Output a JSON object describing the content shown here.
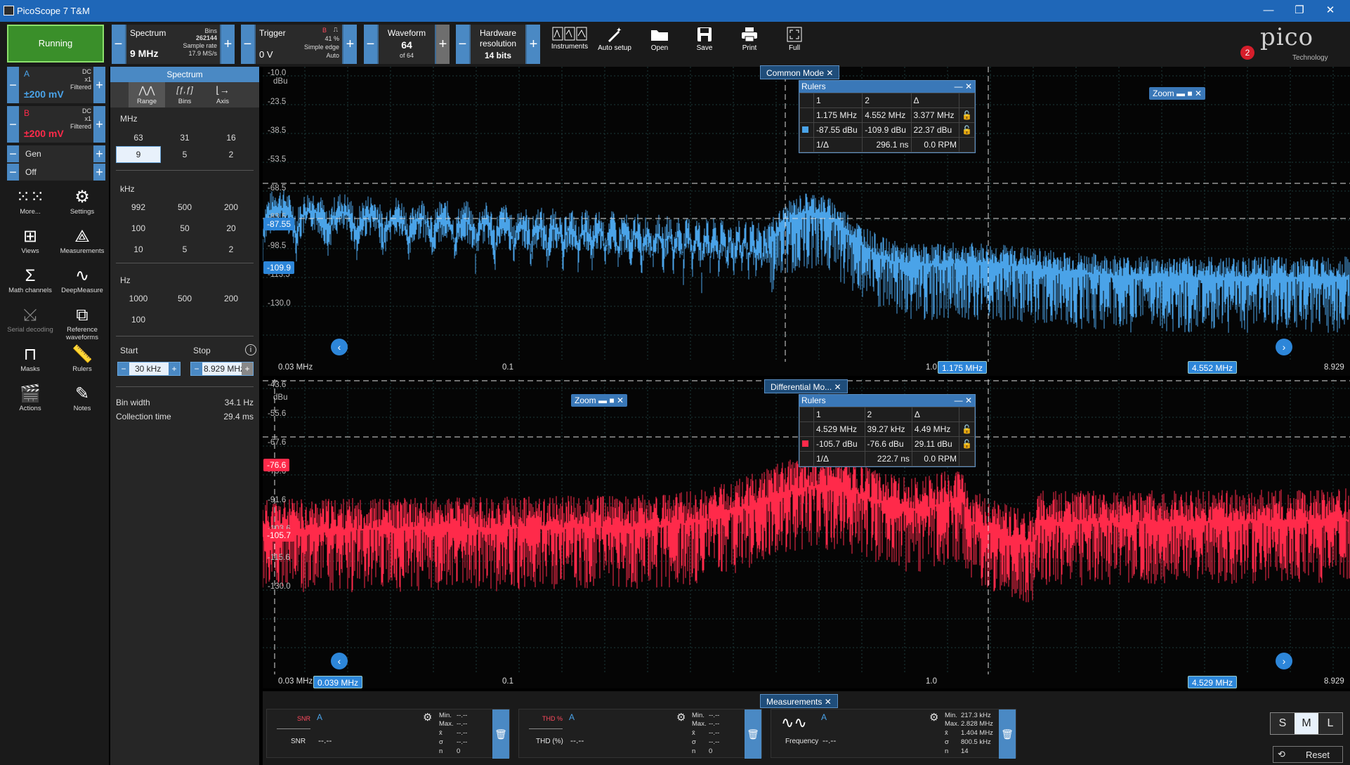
{
  "app": {
    "title": "PicoScope 7 T&M"
  },
  "toolbar": {
    "run_state": "Running",
    "spectrum": {
      "label": "Spectrum",
      "value": "9 MHz",
      "bins_label": "Bins",
      "bins": "262144",
      "sample_rate_label": "Sample rate",
      "sample_rate": "17.9 MS/s"
    },
    "trigger": {
      "label": "Trigger",
      "value": "0 V",
      "channel": "B",
      "percent": "41 %",
      "type": "Simple edge",
      "mode": "Auto"
    },
    "waveform": {
      "label": "Waveform",
      "value": "64",
      "sub": "of 64"
    },
    "resolution": {
      "label1": "Hardware",
      "label2": "resolution",
      "value": "14 bits"
    },
    "tools": [
      {
        "label": "Instruments"
      },
      {
        "label": "Auto setup"
      },
      {
        "label": "Open"
      },
      {
        "label": "Save"
      },
      {
        "label": "Print"
      },
      {
        "label": "Full"
      }
    ],
    "logo_text": "pico",
    "logo_sub": "Technology",
    "notification_count": "2"
  },
  "channels": [
    {
      "name": "A",
      "coupling": "DC",
      "probe": "x1",
      "filter": "Filtered",
      "range": "±200 mV",
      "color": "#4aa3e8"
    },
    {
      "name": "B",
      "coupling": "DC",
      "probe": "x1",
      "filter": "Filtered",
      "range": "±200 mV",
      "color": "#ff2a4a"
    }
  ],
  "gen": {
    "label": "Gen",
    "state": "Off"
  },
  "sidebar_tools": [
    {
      "label": "More...",
      "icon": "grid-dots-icon"
    },
    {
      "label": "Settings",
      "icon": "gear-icon"
    },
    {
      "label": "Views",
      "icon": "views-icon"
    },
    {
      "label": "Measurements",
      "icon": "measurements-icon"
    },
    {
      "label": "Math channels",
      "icon": "sigma-icon"
    },
    {
      "label": "DeepMeasure",
      "icon": "deepmeasure-icon"
    },
    {
      "label": "Serial decoding",
      "icon": "serial-icon"
    },
    {
      "label": "Reference waveforms",
      "icon": "reference-icon"
    },
    {
      "label": "Masks",
      "icon": "masks-icon"
    },
    {
      "label": "Rulers",
      "icon": "rulers-icon"
    },
    {
      "label": "Actions",
      "icon": "actions-icon"
    },
    {
      "label": "Notes",
      "icon": "notes-icon"
    }
  ],
  "spectrum_panel": {
    "title": "Spectrum",
    "tabs": [
      "Range",
      "Bins",
      "Axis"
    ],
    "mhz_label": "MHz",
    "mhz": [
      "63",
      "31",
      "16",
      "9",
      "5",
      "2"
    ],
    "mhz_selected": "9",
    "khz_label": "kHz",
    "khz": [
      "992",
      "500",
      "200",
      "100",
      "50",
      "20",
      "10",
      "5",
      "2"
    ],
    "hz_label": "Hz",
    "hz": [
      "1000",
      "500",
      "200",
      "100"
    ],
    "start_label": "Start",
    "stop_label": "Stop",
    "start": "30 kHz",
    "stop": "8.929 MHz",
    "bin_width_label": "Bin width",
    "bin_width": "34.1 Hz",
    "collection_time_label": "Collection time",
    "collection_time": "29.4 ms"
  },
  "scope1": {
    "title": "Common Mode",
    "unit": "dBu",
    "y_ticks": [
      "-10.0",
      "-23.5",
      "-38.5",
      "-53.5",
      "-68.5",
      "-83.5",
      "-98.5",
      "-113.5",
      "-130.0"
    ],
    "x_ticks": [
      "0.03 MHz",
      "0.1",
      "1.0",
      "8.929"
    ],
    "ruler_h1": "-87.55",
    "ruler_h2": "-109.9",
    "ruler_v1": "1.175 MHz",
    "ruler_v2": "4.552 MHz",
    "rulers": {
      "title": "Rulers",
      "c1": "1",
      "c2": "2",
      "c3": "Δ",
      "r1": [
        "1.175 MHz",
        "4.552 MHz",
        "3.377 MHz"
      ],
      "r2": [
        "-87.55 dBu",
        "-109.9 dBu",
        "22.37 dBu"
      ],
      "r3": [
        "1/Δ",
        "296.1 ns",
        "0.0 RPM"
      ]
    },
    "zoom": "Zoom",
    "chart_data": {
      "type": "line",
      "series": [
        {
          "name": "A",
          "color": "#4aa3e8"
        }
      ],
      "xlim": [
        0.03,
        8.929
      ],
      "ylim": [
        -140,
        -10
      ],
      "xscale": "log"
    }
  },
  "scope2": {
    "title": "Differential Mo...",
    "unit": "dBu",
    "y_ticks": [
      "-43.6",
      "-55.6",
      "-67.6",
      "-79.6",
      "-91.6",
      "-103.6",
      "-115.6",
      "-130.0"
    ],
    "x_ticks": [
      "0.03 MHz",
      "0.1",
      "1.0",
      "8.929"
    ],
    "ruler_h1": "-76.6",
    "ruler_h2": "-105.7",
    "ruler_v1": "0.039 MHz",
    "ruler_v2": "4.529 MHz",
    "rulers": {
      "title": "Rulers",
      "c1": "1",
      "c2": "2",
      "c3": "Δ",
      "r1": [
        "4.529 MHz",
        "39.27 kHz",
        "4.49 MHz"
      ],
      "r2": [
        "-105.7 dBu",
        "-76.6 dBu",
        "29.11 dBu"
      ],
      "r3": [
        "1/Δ",
        "222.7 ns",
        "0.0 RPM"
      ]
    },
    "zoom": "Zoom",
    "chart_data": {
      "type": "line",
      "series": [
        {
          "name": "B",
          "color": "#ff2a4a"
        }
      ],
      "xlim": [
        0.03,
        8.929
      ],
      "ylim": [
        -140,
        -43.6
      ],
      "xscale": "log"
    }
  },
  "measurements": {
    "title": "Measurements",
    "cards": [
      {
        "name": "SNR",
        "channel": "A",
        "value": "--.--",
        "min": "--.--",
        "max": "--.--",
        "mean": "--.--",
        "sigma": "--.--",
        "n": "0"
      },
      {
        "name": "THD (%)",
        "channel": "A",
        "value": "--.--",
        "min": "--.--",
        "max": "--.--",
        "mean": "--.--",
        "sigma": "--.--",
        "n": "0"
      },
      {
        "name": "Frequency",
        "channel": "A",
        "value": "--.--",
        "min": "217.3 kHz",
        "max": "2.828 MHz",
        "mean": "1.404 MHz",
        "sigma": "800.5 kHz",
        "n": "14"
      }
    ],
    "stat_labels": {
      "min": "Min.",
      "max": "Max.",
      "mean": "x̄",
      "sigma": "σ",
      "n": "n"
    },
    "sizes": [
      "S",
      "M",
      "L"
    ],
    "reset": "Reset"
  }
}
